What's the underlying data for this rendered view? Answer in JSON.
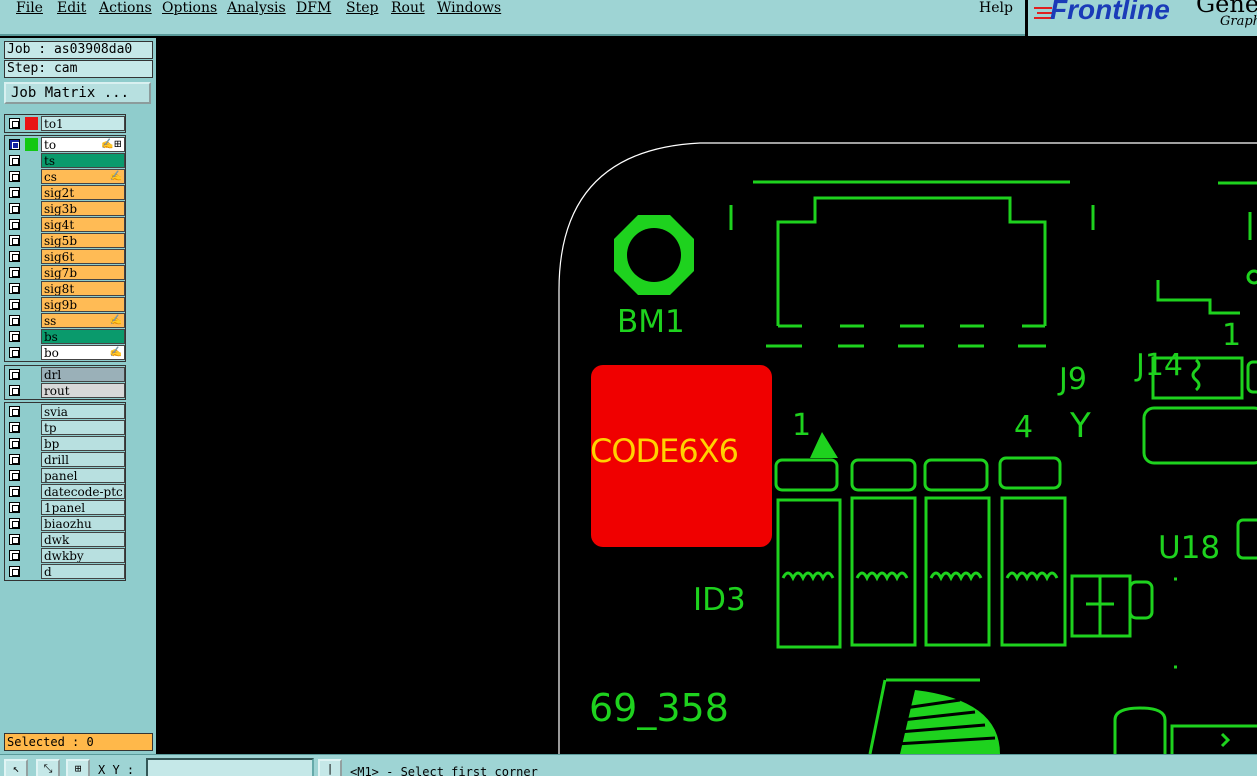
{
  "menu": {
    "file": "File",
    "edit": "Edit",
    "actions": "Actions",
    "options": "Options",
    "analysis": "Analysis",
    "dfm": "DFM",
    "step": "Step",
    "rout": "Rout",
    "windows": "Windows",
    "help": "Help"
  },
  "logo": {
    "brand": "Frontline",
    "product": "Gene",
    "subtitle": "Graph"
  },
  "info": {
    "job": "Job : as03908da0",
    "step": "Step: cam"
  },
  "job_matrix_label": "Job Matrix ...",
  "layers_board": [
    {
      "name": "to",
      "color": "#ffffff",
      "swatch": "#12c812",
      "checked": true,
      "mark": "✍⊞"
    },
    {
      "name": "ts",
      "color": "#0a9a6c",
      "swatch": "",
      "checked": false,
      "mark": ""
    },
    {
      "name": "cs",
      "color": "#ffbb55",
      "swatch": "",
      "checked": false,
      "mark": "✍"
    },
    {
      "name": "sig2t",
      "color": "#ffbb55",
      "swatch": "",
      "checked": false,
      "mark": ""
    },
    {
      "name": "sig3b",
      "color": "#ffbb55",
      "swatch": "",
      "checked": false,
      "mark": ""
    },
    {
      "name": "sig4t",
      "color": "#ffbb55",
      "swatch": "",
      "checked": false,
      "mark": ""
    },
    {
      "name": "sig5b",
      "color": "#ffbb55",
      "swatch": "",
      "checked": false,
      "mark": ""
    },
    {
      "name": "sig6t",
      "color": "#ffbb55",
      "swatch": "",
      "checked": false,
      "mark": ""
    },
    {
      "name": "sig7b",
      "color": "#ffbb55",
      "swatch": "",
      "checked": false,
      "mark": ""
    },
    {
      "name": "sig8t",
      "color": "#ffbb55",
      "swatch": "",
      "checked": false,
      "mark": ""
    },
    {
      "name": "sig9b",
      "color": "#ffbb55",
      "swatch": "",
      "checked": false,
      "mark": ""
    },
    {
      "name": "ss",
      "color": "#ffbb55",
      "swatch": "",
      "checked": false,
      "mark": "✍"
    },
    {
      "name": "bs",
      "color": "#0a9a6c",
      "swatch": "",
      "checked": false,
      "mark": ""
    },
    {
      "name": "bo",
      "color": "#ffffff",
      "swatch": "",
      "checked": false,
      "mark": "✍"
    }
  ],
  "layer_top": {
    "name": "to1",
    "color": "#c5e8e8",
    "swatch": "#e81414"
  },
  "layers_drill": [
    {
      "name": "drl",
      "color": "#9ab0b8"
    },
    {
      "name": "rout",
      "color": "#d8d8d8"
    }
  ],
  "layers_misc": [
    {
      "name": "svia"
    },
    {
      "name": "tp"
    },
    {
      "name": "bp"
    },
    {
      "name": "drill"
    },
    {
      "name": "panel"
    },
    {
      "name": "datecode-ptc"
    },
    {
      "name": "1panel"
    },
    {
      "name": "biaozhu"
    },
    {
      "name": "dwk"
    },
    {
      "name": "dwkby"
    },
    {
      "name": "d"
    }
  ],
  "selected_text": "Selected : 0",
  "bottom": {
    "xy_label": "X Y :",
    "message": "<M1> - Select first corner"
  },
  "pcb_labels": {
    "bm1": "BM1",
    "code": "CODE6X6",
    "id3": "ID3",
    "num": "69_358",
    "pin1": "1",
    "pin4": "4",
    "j9": "J9",
    "y": "Y",
    "j14": "J14",
    "j14_1": "1",
    "u18": "U18"
  },
  "colors": {
    "pcb_green": "#1ed21e",
    "pad_red": "#f00000",
    "code_text": "#ffd200"
  }
}
